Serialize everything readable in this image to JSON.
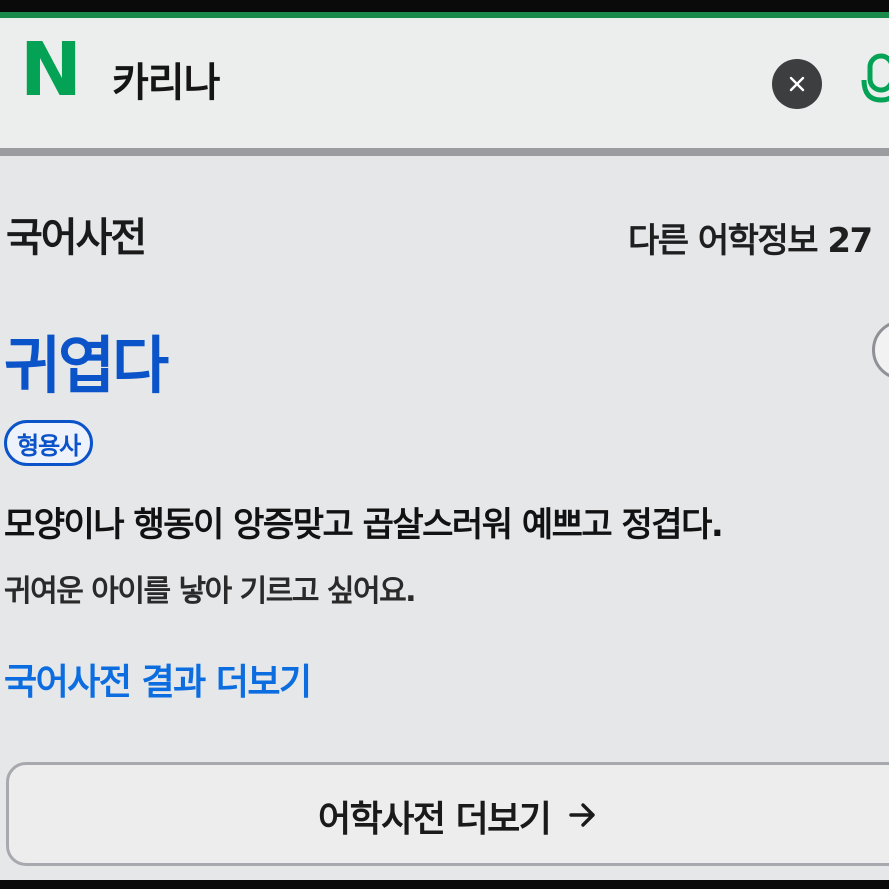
{
  "search": {
    "logo": "N",
    "query": "카리나",
    "clear_icon": "close-icon",
    "mic_icon": "microphone-icon"
  },
  "dictionary": {
    "section_title": "국어사전",
    "other_info": "다른 어학정보 27",
    "headword": "귀엽다",
    "part_of_speech": "형용사",
    "definition": "모양이나 행동이 앙증맞고 곱살스러워 예쁘고 정겹다.",
    "example": "귀여운 아이를 낳아 기르고 싶어요.",
    "more_link": "국어사전 결과 더보기",
    "language_dict_button": "어학사전 더보기",
    "arrow_icon": "arrow-right-icon"
  },
  "colors": {
    "naver_green": "#03a254",
    "headword_blue": "#0b53c8",
    "link_blue": "#0b6de0",
    "background": "#e6e7e9"
  }
}
